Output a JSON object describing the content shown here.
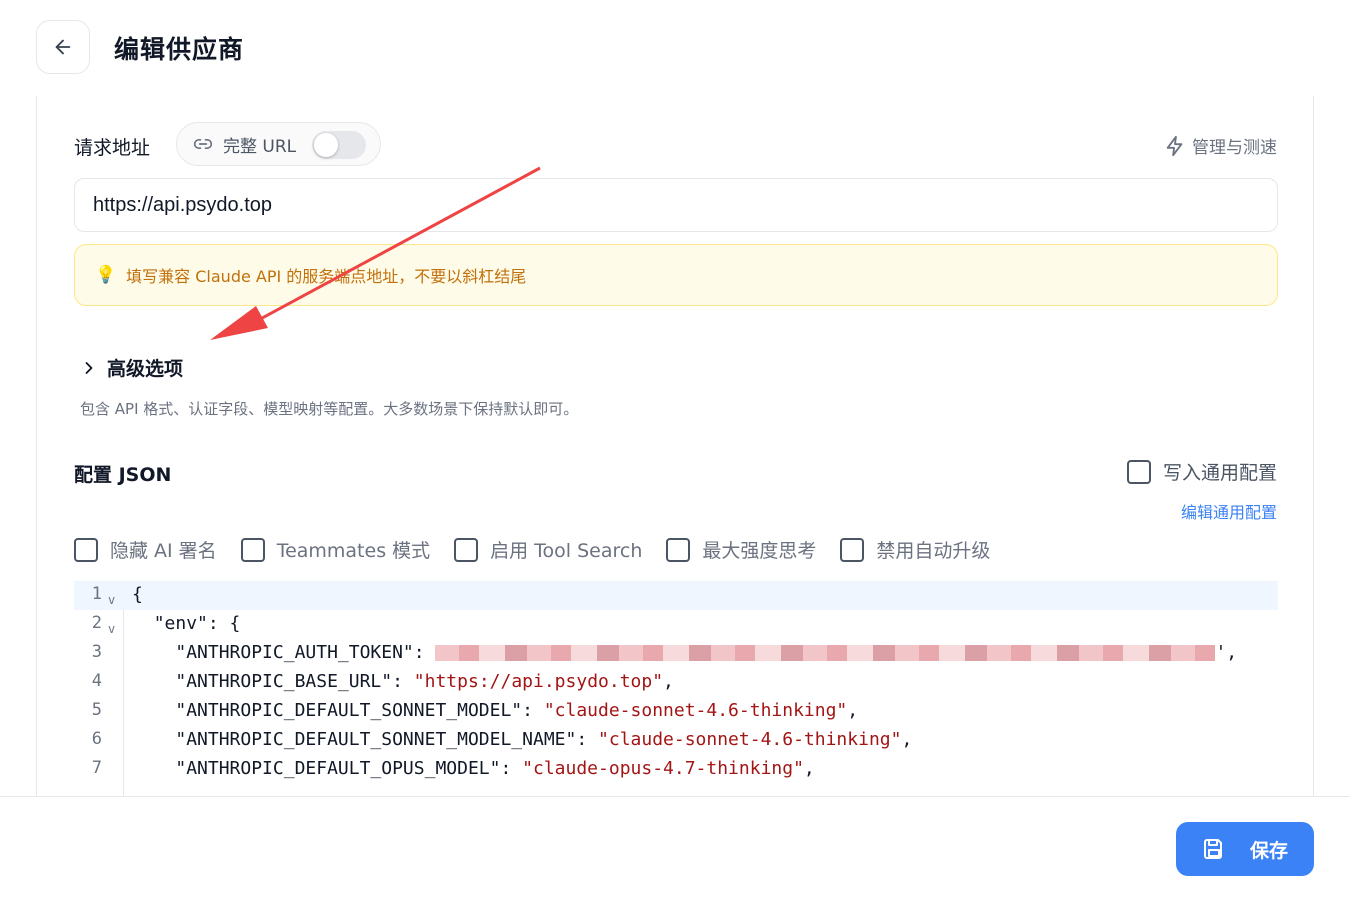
{
  "header": {
    "title": "编辑供应商",
    "back_icon": "arrow-left-icon"
  },
  "request": {
    "label": "请求地址",
    "full_url_label": "完整 URL",
    "full_url_enabled": false,
    "manage_label": "管理与测速",
    "url_value": "https://api.psydo.top",
    "hint": "填写兼容 Claude API 的服务端点地址，不要以斜杠结尾"
  },
  "advanced": {
    "title": "高级选项",
    "description": "包含 API 格式、认证字段、模型映射等配置。大多数场景下保持默认即可。"
  },
  "config": {
    "label": "配置 JSON",
    "write_common_label": "写入通用配置",
    "edit_common_label": "编辑通用配置",
    "options": [
      {
        "label": "隐藏 AI 署名",
        "checked": false
      },
      {
        "label": "Teammates 模式",
        "checked": false
      },
      {
        "label": "启用 Tool Search",
        "checked": false
      },
      {
        "label": "最大强度思考",
        "checked": false
      },
      {
        "label": "禁用自动升级",
        "checked": false
      }
    ],
    "editor": {
      "lines": [
        {
          "n": "1",
          "key": "",
          "text": "{"
        },
        {
          "n": "2",
          "key": "\"env\"",
          "text": ": {"
        },
        {
          "n": "3",
          "key": "\"ANTHROPIC_AUTH_TOKEN\"",
          "text": ":"
        },
        {
          "n": "4",
          "key": "\"ANTHROPIC_BASE_URL\"",
          "value": "\"https://api.psydo.top\""
        },
        {
          "n": "5",
          "key": "\"ANTHROPIC_DEFAULT_SONNET_MODEL\"",
          "value": "\"claude-sonnet-4.6-thinking\""
        },
        {
          "n": "6",
          "key": "\"ANTHROPIC_DEFAULT_SONNET_MODEL_NAME\"",
          "value": "\"claude-sonnet-4.6-thinking\""
        },
        {
          "n": "7",
          "key": "\"ANTHROPIC_DEFAULT_OPUS_MODEL\"",
          "value": "\"claude-opus-4.7-thinking\""
        }
      ]
    }
  },
  "footer": {
    "save_label": "保存"
  },
  "colors": {
    "accent": "#3b82f6",
    "hint_bg": "#fefce8",
    "hint_text": "#c2700c",
    "annotation_arrow": "#ef4444",
    "string_value": "#a31515"
  }
}
